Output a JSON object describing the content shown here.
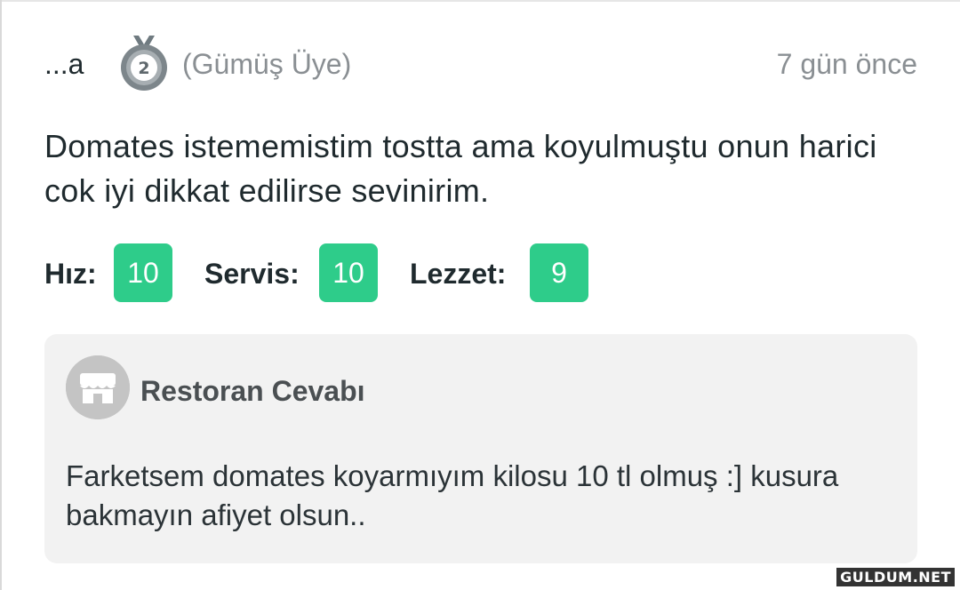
{
  "review": {
    "username": "...a",
    "medal_icon": "silver-medal-icon",
    "medal_number": "2",
    "member_level": "(Gümüş Üye)",
    "timestamp": "7 gün önce",
    "text": "Domates istememistim tostta ama koyulmuştu onun harici cok iyi dikkat edilirse sevinirim."
  },
  "ratings": [
    {
      "label": "Hız:",
      "score": "10"
    },
    {
      "label": "Servis:",
      "score": "10"
    },
    {
      "label": "Lezzet:",
      "score": "9"
    }
  ],
  "reply": {
    "icon": "store-icon",
    "title": "Restoran Cevabı",
    "text": "Farketsem domates koyarmıyım kilosu 10 tl olmuş :] kusura bakmayın afiyet olsun.."
  },
  "watermark": "GULDUM.NET",
  "colors": {
    "score_bg": "#2ecc8a",
    "muted_text": "#8a8f93",
    "reply_bg": "#f2f2f2"
  }
}
